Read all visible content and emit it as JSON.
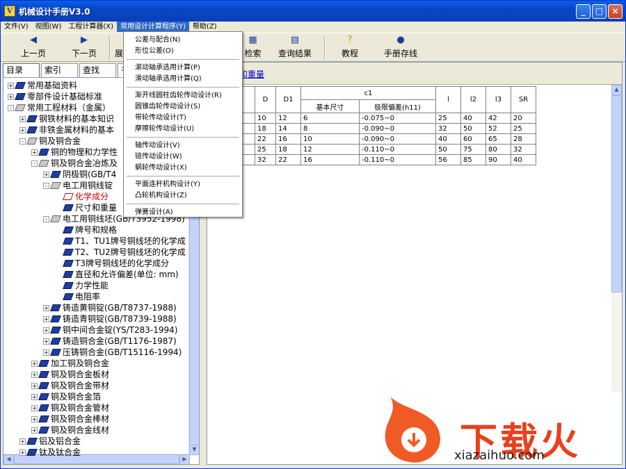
{
  "window": {
    "title": "机械设计手册V3.0",
    "app_icon": "V"
  },
  "menubar": {
    "items": [
      "文件(V)",
      "视图(W)",
      "工程计算器(X)",
      "常用设计计算程序(Y)",
      "帮助(Z)"
    ],
    "active_index": 3
  },
  "toolbar": {
    "prev": "上一页",
    "next": "下一页",
    "expand_partial": "展",
    "search": "检索",
    "results": "查询结果",
    "tutorial": "教程",
    "handbook": "手册存线"
  },
  "tabs": [
    "目录",
    "索引",
    "查找",
    "书"
  ],
  "dropdown": {
    "items": [
      "公差与配合(N)",
      "形位公差(O)",
      "滚动轴承选用计算(P)",
      "滑动轴承选用计算(Q)",
      "渐开线圆柱齿轮传动设计(R)",
      "圆锥齿轮传动设计(S)",
      "带轮传动设计(T)",
      "摩擦轮传动设计(U)",
      "轴传动设计(V)",
      "链传动设计(W)",
      "蜗轮传动设计(X)",
      "平面连杆机构设计(Y)",
      "凸轮机构设计(Z)",
      "弹簧设计(A)"
    ]
  },
  "tree": {
    "rows": [
      {
        "text": "常用基础资料",
        "level": 0,
        "exp": "+"
      },
      {
        "text": "零部件设计基础标准",
        "level": 0,
        "exp": "+"
      },
      {
        "text": "常用工程材料（金属）",
        "level": 0,
        "exp": "-"
      },
      {
        "text": "钢铁材料的基本知识",
        "level": 1,
        "exp": "+"
      },
      {
        "text": "非铁金属材料的基本",
        "level": 1,
        "exp": "+"
      },
      {
        "text": "铜及铜合金",
        "level": 1,
        "exp": "-"
      },
      {
        "text": "铜的物理和力学性",
        "level": 2,
        "exp": "+"
      },
      {
        "text": "铜及铜合金冶炼及",
        "level": 2,
        "exp": "-"
      },
      {
        "text": "阴极铜(GB/T4",
        "level": 3,
        "exp": "+"
      },
      {
        "text": "电工用铜线锭",
        "level": 3,
        "exp": "-"
      },
      {
        "text": "化学成分",
        "level": 4,
        "exp": "",
        "hl": true
      },
      {
        "text": "尺寸和重量",
        "level": 4,
        "exp": ""
      },
      {
        "text": "电工用铜线坯(GB/T3952-1998)",
        "level": 3,
        "exp": "-"
      },
      {
        "text": "牌号和规格",
        "level": 4,
        "exp": ""
      },
      {
        "text": "T1、TU1牌号铜线坯的化学成",
        "level": 4,
        "exp": ""
      },
      {
        "text": "T2、TU2牌号铜线坯的化学成",
        "level": 4,
        "exp": ""
      },
      {
        "text": "T3牌号铜线坯的化学成分",
        "level": 4,
        "exp": ""
      },
      {
        "text": "直径和允许偏差(单位: mm)",
        "level": 4,
        "exp": ""
      },
      {
        "text": "力学性能",
        "level": 4,
        "exp": ""
      },
      {
        "text": "电阻率",
        "level": 4,
        "exp": ""
      },
      {
        "text": "铸造黄铜锭(GB/T8737-1988)",
        "level": 3,
        "exp": "+"
      },
      {
        "text": "铸造青铜锭(GB/T8739-1988)",
        "level": 3,
        "exp": "+"
      },
      {
        "text": "铜中间合金锭(YS/T283-1994)",
        "level": 3,
        "exp": "+"
      },
      {
        "text": "铸造铜合金(GB/T1176-1987)",
        "level": 3,
        "exp": "+"
      },
      {
        "text": "压铸铜合金(GB/T15116-1994)",
        "level": 3,
        "exp": "+"
      },
      {
        "text": "加工铜及铜合金",
        "level": 2,
        "exp": "+"
      },
      {
        "text": "铜及铜合金板材",
        "level": 2,
        "exp": "+"
      },
      {
        "text": "铜及铜合金带材",
        "level": 2,
        "exp": "+"
      },
      {
        "text": "铜及铜合金箔",
        "level": 2,
        "exp": "+"
      },
      {
        "text": "铜及铜合金管材",
        "level": 2,
        "exp": "+"
      },
      {
        "text": "铜及铜合金棒材",
        "level": 2,
        "exp": "+"
      },
      {
        "text": "铜及铜合金线材",
        "level": 2,
        "exp": "+"
      },
      {
        "text": "铝及铝合金",
        "level": 1,
        "exp": "+"
      },
      {
        "text": "钛及钛合金",
        "level": 1,
        "exp": "+"
      }
    ]
  },
  "content": {
    "title": "和重量",
    "headers": {
      "d_col": "D",
      "d1_col": "D1",
      "c1_group": "c1",
      "base": "基本尺寸",
      "limit": "极限偏差(h11)",
      "l_col": "l",
      "l2_col": "l2",
      "l3_col": "l3",
      "sr_col": "SR"
    },
    "rows": [
      {
        "d": "10",
        "d1": "12",
        "base": "6",
        "limit": "-0.075~0",
        "l": "25",
        "l2": "40",
        "l3": "42",
        "sr": "20"
      },
      {
        "d": "18",
        "d1": "14",
        "base": "8",
        "limit": "-0.090~0",
        "l": "32",
        "l2": "50",
        "l3": "52",
        "sr": "25"
      },
      {
        "d": "22",
        "d1": "16",
        "base": "10",
        "limit": "-0.090~0",
        "l": "40",
        "l2": "60",
        "l3": "65",
        "sr": "28"
      },
      {
        "d": "25",
        "d1": "18",
        "base": "12",
        "limit": "-0.110~0",
        "l": "50",
        "l2": "75",
        "l3": "80",
        "sr": "32"
      },
      {
        "d": "32",
        "d1": "22",
        "base": "16",
        "limit": "-0.110~0",
        "l": "56",
        "l2": "85",
        "l3": "90",
        "sr": "40"
      }
    ]
  },
  "watermark": {
    "text": "下载火",
    "url": "xiazaihuo.com"
  }
}
